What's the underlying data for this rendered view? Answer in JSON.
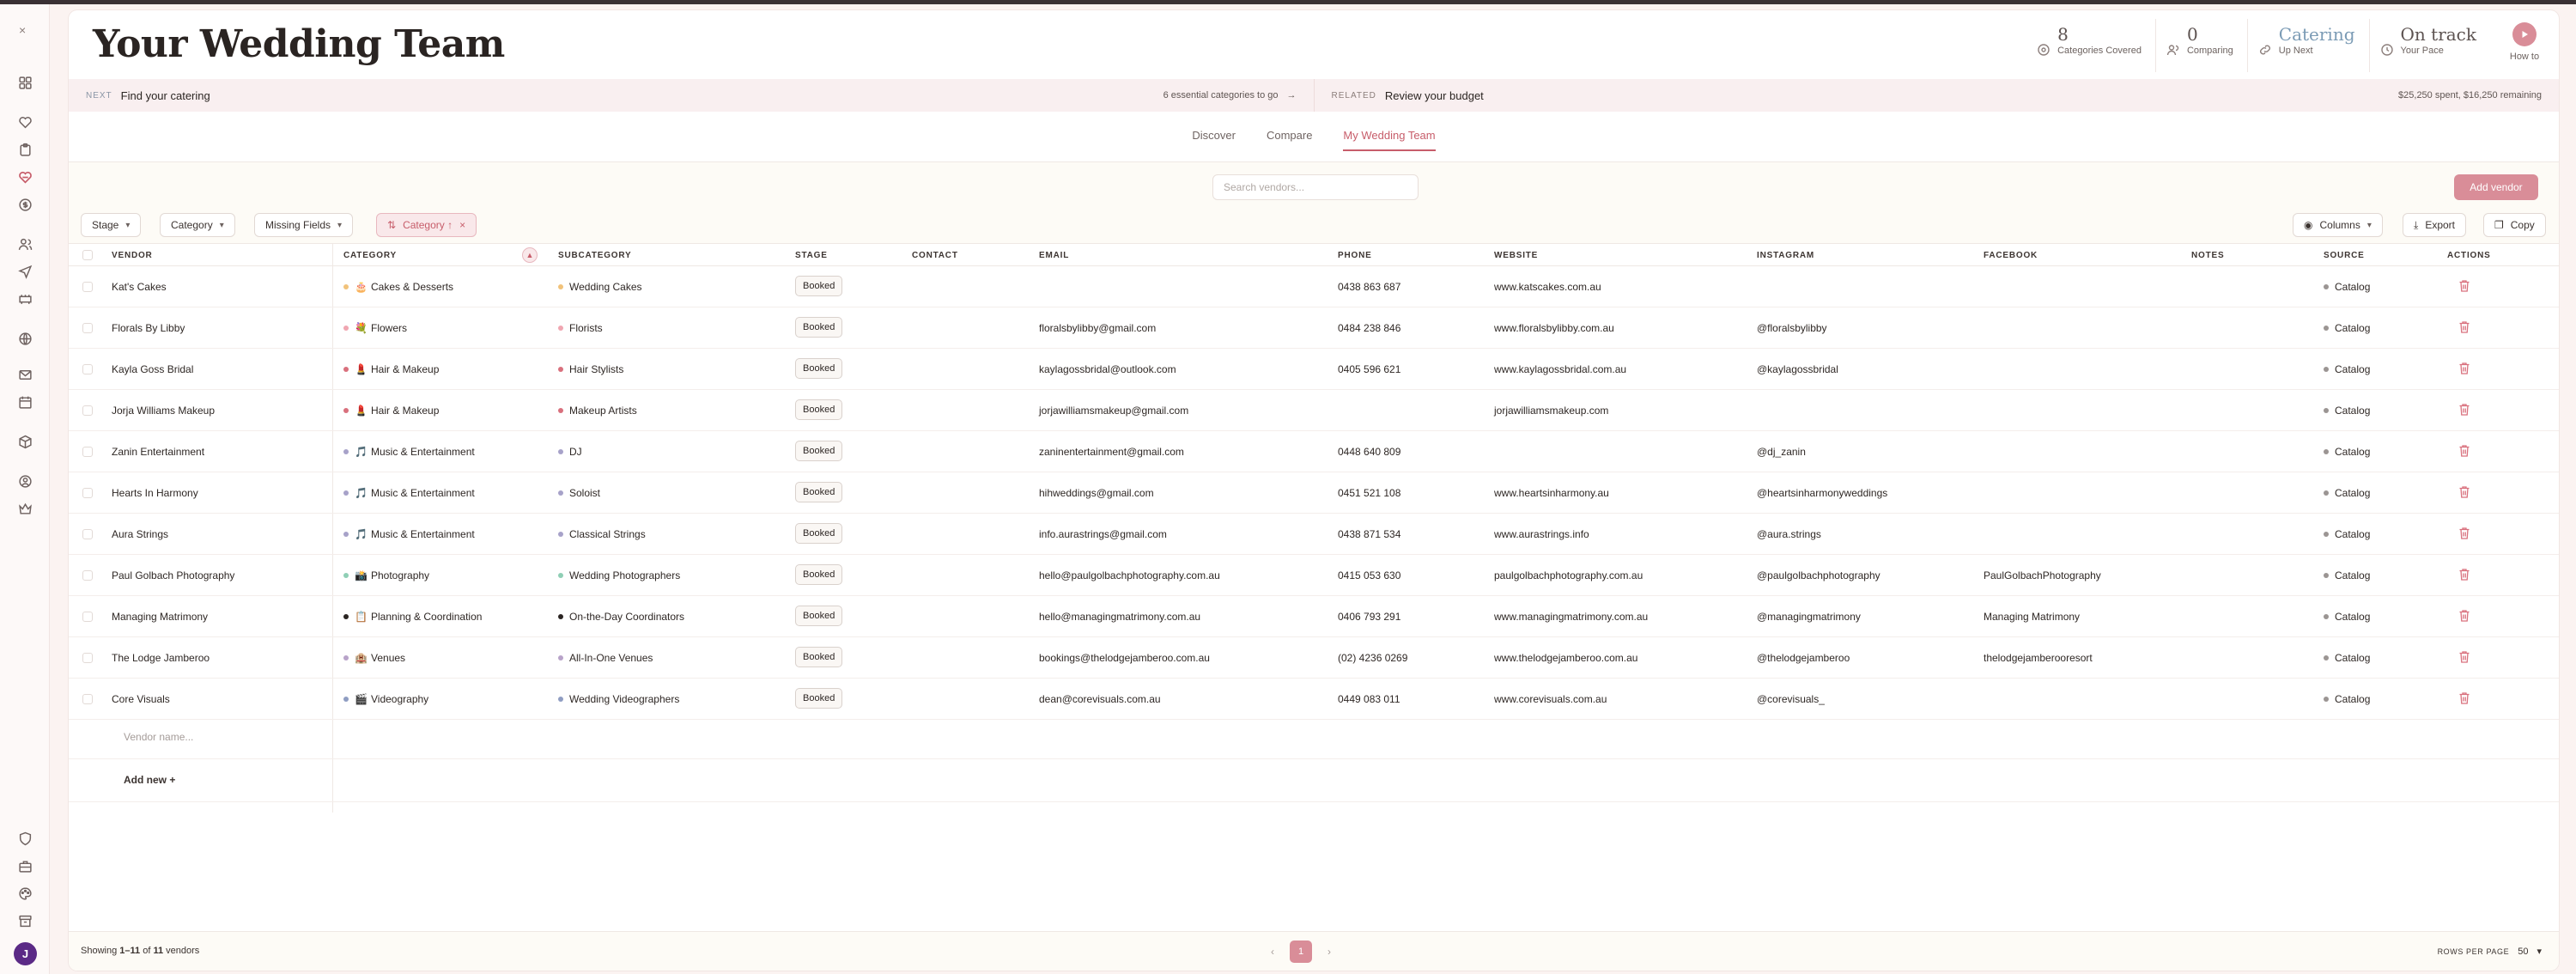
{
  "sidebar": {
    "close": "×",
    "avatar": "J"
  },
  "header": {
    "title": "Your Wedding Team",
    "stats": [
      {
        "value": "8",
        "label": "Categories Covered",
        "accent": false
      },
      {
        "value": "0",
        "label": "Comparing",
        "accent": false
      },
      {
        "value": "Catering",
        "label": "Up Next",
        "accent": true
      },
      {
        "value": "On track",
        "label": "Your Pace",
        "accent": false
      }
    ],
    "how_to": "How to"
  },
  "next_bar": {
    "next_tag": "NEXT",
    "next_text": "Find your catering",
    "next_right": "6 essential categories to go",
    "related_tag": "RELATED",
    "related_text": "Review your budget",
    "related_right": "$25,250 spent, $16,250 remaining"
  },
  "tabs": [
    {
      "label": "Discover",
      "active": false
    },
    {
      "label": "Compare",
      "active": false
    },
    {
      "label": "My Wedding Team",
      "active": true
    }
  ],
  "toolbar": {
    "search_placeholder": "Search vendors...",
    "add_vendor": "Add vendor",
    "filters": {
      "stage": "Stage",
      "category": "Category",
      "missing": "Missing Fields",
      "sort": "Category ↑"
    },
    "columns": "Columns",
    "export": "Export",
    "copy": "Copy"
  },
  "table": {
    "headers": {
      "vendor": "VENDOR",
      "category": "CATEGORY",
      "subcategory": "SUBCATEGORY",
      "stage": "STAGE",
      "contact": "CONTACT",
      "email": "EMAIL",
      "phone": "PHONE",
      "website": "WEBSITE",
      "instagram": "INSTAGRAM",
      "facebook": "FACEBOOK",
      "notes": "NOTES",
      "source": "SOURCE",
      "actions": "ACTIONS"
    },
    "rows": [
      {
        "vendor": "Kat's Cakes",
        "cat_emoji": "🎂",
        "category": "Cakes & Desserts",
        "cat_color": "#f1c27a",
        "subcategory": "Wedding Cakes",
        "sub_color": "#f1c27a",
        "stage": "Booked",
        "email": "",
        "phone": "0438 863 687",
        "website": "www.katscakes.com.au",
        "instagram": "",
        "facebook": "",
        "source": "Catalog"
      },
      {
        "vendor": "Florals By Libby",
        "cat_emoji": "💐",
        "category": "Flowers",
        "cat_color": "#f0a6b1",
        "subcategory": "Florists",
        "sub_color": "#f0a6b1",
        "stage": "Booked",
        "email": "floralsbylibby@gmail.com",
        "phone": "0484 238 846",
        "website": "www.floralsbylibby.com.au",
        "instagram": "@floralsbylibby",
        "facebook": "",
        "source": "Catalog"
      },
      {
        "vendor": "Kayla Goss Bridal",
        "cat_emoji": "💄",
        "category": "Hair & Makeup",
        "cat_color": "#d9707d",
        "subcategory": "Hair Stylists",
        "sub_color": "#d9707d",
        "stage": "Booked",
        "email": "kaylagossbridal@outlook.com",
        "phone": "0405 596 621",
        "website": "www.kaylagossbridal.com.au",
        "instagram": "@kaylagossbridal",
        "facebook": "",
        "source": "Catalog"
      },
      {
        "vendor": "Jorja Williams Makeup",
        "cat_emoji": "💄",
        "category": "Hair & Makeup",
        "cat_color": "#d9707d",
        "subcategory": "Makeup Artists",
        "sub_color": "#d9707d",
        "stage": "Booked",
        "email": "jorjawilliamsmakeup@gmail.com",
        "phone": "",
        "website": "jorjawilliamsmakeup.com",
        "instagram": "",
        "facebook": "",
        "source": "Catalog"
      },
      {
        "vendor": "Zanin Entertainment",
        "cat_emoji": "🎵",
        "category": "Music & Entertainment",
        "cat_color": "#a7a2c9",
        "subcategory": "DJ",
        "sub_color": "#a7a2c9",
        "stage": "Booked",
        "email": "zaninentertainment@gmail.com",
        "phone": "0448 640 809",
        "website": "",
        "instagram": "@dj_zanin",
        "facebook": "",
        "source": "Catalog"
      },
      {
        "vendor": "Hearts In Harmony",
        "cat_emoji": "🎵",
        "category": "Music & Entertainment",
        "cat_color": "#a7a2c9",
        "subcategory": "Soloist",
        "sub_color": "#a7a2c9",
        "stage": "Booked",
        "email": "hihweddings@gmail.com",
        "phone": "0451 521 108",
        "website": "www.heartsinharmony.au",
        "instagram": "@heartsinharmonyweddings",
        "facebook": "",
        "source": "Catalog"
      },
      {
        "vendor": "Aura Strings",
        "cat_emoji": "🎵",
        "category": "Music & Entertainment",
        "cat_color": "#a7a2c9",
        "subcategory": "Classical Strings",
        "sub_color": "#a7a2c9",
        "stage": "Booked",
        "email": "info.aurastrings@gmail.com",
        "phone": "0438 871 534",
        "website": "www.aurastrings.info",
        "instagram": "@aura.strings",
        "facebook": "",
        "source": "Catalog"
      },
      {
        "vendor": "Paul Golbach Photography",
        "cat_emoji": "📸",
        "category": "Photography",
        "cat_color": "#8fcfb5",
        "subcategory": "Wedding Photographers",
        "sub_color": "#8fcfb5",
        "stage": "Booked",
        "email": "hello@paulgolbachphotography.com.au",
        "phone": "0415 053 630",
        "website": "paulgolbachphotography.com.au",
        "instagram": "@paulgolbachphotography",
        "facebook": "PaulGolbachPhotography",
        "source": "Catalog"
      },
      {
        "vendor": "Managing Matrimony",
        "cat_emoji": "📋",
        "category": "Planning & Coordination",
        "cat_color": "#2a2422",
        "subcategory": "On-the-Day Coordinators",
        "sub_color": "#2a2422",
        "stage": "Booked",
        "email": "hello@managingmatrimony.com.au",
        "phone": "0406 793 291",
        "website": "www.managingmatrimony.com.au",
        "instagram": "@managingmatrimony",
        "facebook": "Managing Matrimony",
        "source": "Catalog"
      },
      {
        "vendor": "The Lodge Jamberoo",
        "cat_emoji": "🏨",
        "category": "Venues",
        "cat_color": "#b8a3c9",
        "subcategory": "All-In-One Venues",
        "sub_color": "#b8a3c9",
        "stage": "Booked",
        "email": "bookings@thelodgejamberoo.com.au",
        "phone": "(02) 4236 0269",
        "website": "www.thelodgejamberoo.com.au",
        "instagram": "@thelodgejamberoo",
        "facebook": "thelodgejamberooresort",
        "source": "Catalog"
      },
      {
        "vendor": "Core Visuals",
        "cat_emoji": "🎬",
        "category": "Videography",
        "cat_color": "#8f9dc2",
        "subcategory": "Wedding Videographers",
        "sub_color": "#8f9dc2",
        "stage": "Booked",
        "email": "dean@corevisuals.com.au",
        "phone": "0449 083 011",
        "website": "www.corevisuals.com.au",
        "instagram": "@corevisuals_",
        "facebook": "",
        "source": "Catalog"
      }
    ],
    "new_vendor_placeholder": "Vendor name...",
    "add_new": "Add new +"
  },
  "footer": {
    "showing_prefix": "Showing ",
    "showing_range": "1–11",
    "showing_mid": " of ",
    "showing_total": "11",
    "showing_suffix": " vendors",
    "page": "1",
    "rows_per_page_label": "ROWS PER PAGE",
    "rows_per_page": "50"
  },
  "colors": {
    "accent": "#c75d6a",
    "accent_soft": "#d98d98",
    "link_blue": "#7b9bb5"
  }
}
